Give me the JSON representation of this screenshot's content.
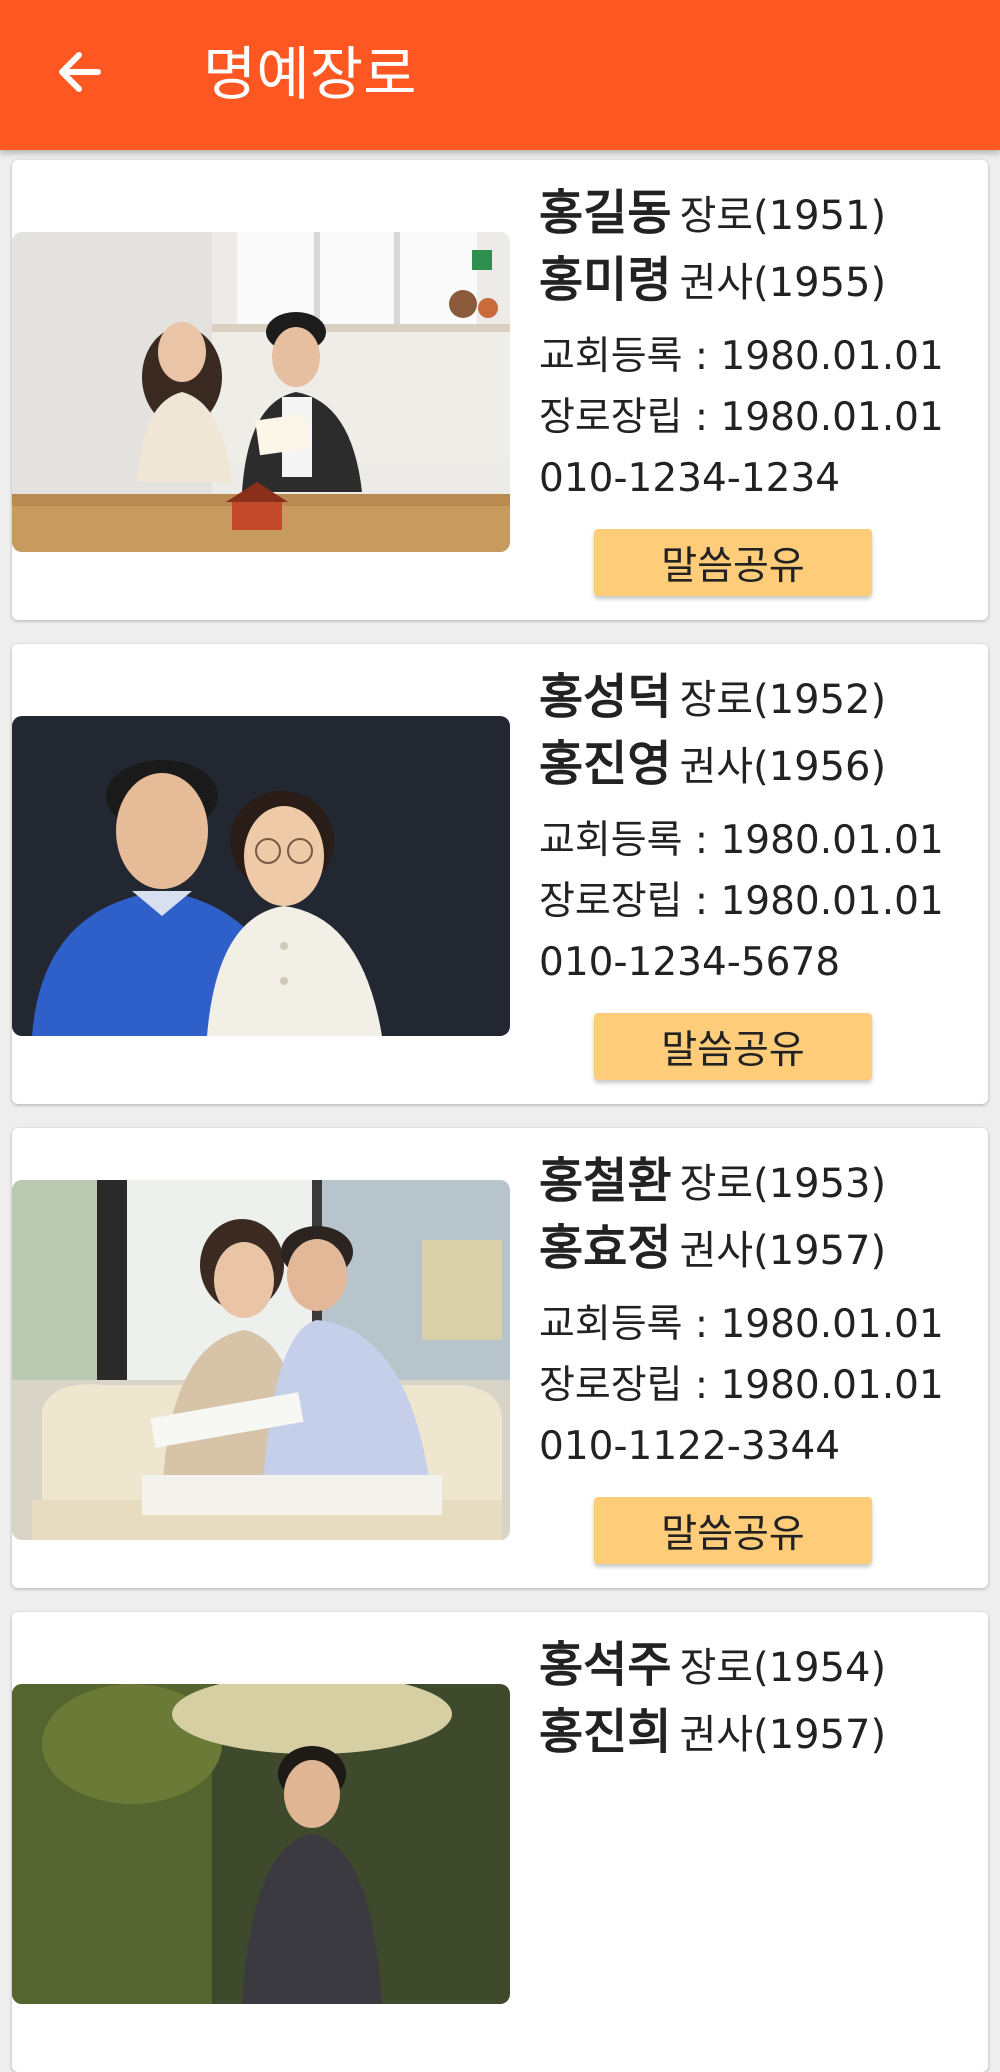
{
  "app": {
    "title": "명예장로"
  },
  "cards": [
    {
      "elder_name": "홍길동",
      "elder_role": "장로(1951)",
      "spouse_name": "홍미령",
      "spouse_role": "권사(1955)",
      "church_reg": "교회등록 : 1980.01.01",
      "elder_install": "장로장립 : 1980.01.01",
      "phone": "010-1234-1234",
      "share_label": "말씀공유"
    },
    {
      "elder_name": "홍성덕",
      "elder_role": "장로(1952)",
      "spouse_name": "홍진영",
      "spouse_role": "권사(1956)",
      "church_reg": "교회등록 : 1980.01.01",
      "elder_install": "장로장립 : 1980.01.01",
      "phone": "010-1234-5678",
      "share_label": "말씀공유"
    },
    {
      "elder_name": "홍철환",
      "elder_role": "장로(1953)",
      "spouse_name": "홍효정",
      "spouse_role": "권사(1957)",
      "church_reg": "교회등록 : 1980.01.01",
      "elder_install": "장로장립 : 1980.01.01",
      "phone": "010-1122-3344",
      "share_label": "말씀공유"
    },
    {
      "elder_name": "홍석주",
      "elder_role": "장로(1954)",
      "spouse_name": "홍진희",
      "spouse_role": "권사(1957)"
    }
  ]
}
